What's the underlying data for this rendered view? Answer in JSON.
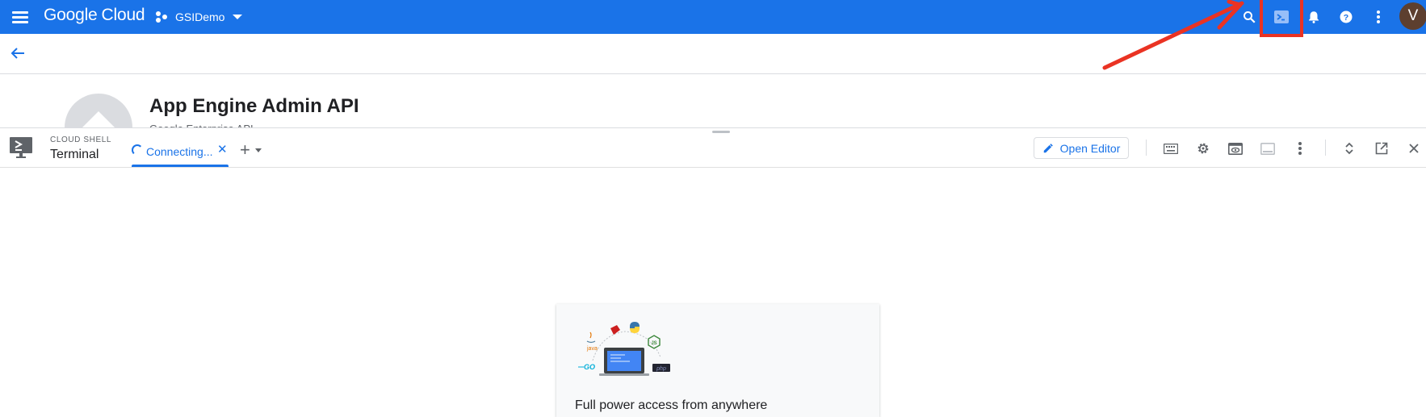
{
  "topbar": {
    "brand_google": "Google",
    "brand_cloud": "Cloud",
    "project_name": "GSIDemo",
    "avatar_initial": "V",
    "colors": {
      "bar": "#1a73e8",
      "highlight": "#ea3323",
      "avatar": "#5d3f2f"
    },
    "icons": [
      "menu-icon",
      "project-dots-icon",
      "search-icon",
      "cloud-shell-icon",
      "notifications-bell-icon",
      "help-icon",
      "more-vert-icon"
    ]
  },
  "page": {
    "title": "App Engine Admin API",
    "subtitle": "Google Enterprise API"
  },
  "cloud_shell": {
    "kicker": "CLOUD SHELL",
    "title": "Terminal",
    "tab_label": "Connecting...",
    "open_editor_label": "Open Editor",
    "icons": [
      "keyboard-icon",
      "settings-icon",
      "web-preview-icon",
      "minimize-panel-icon",
      "more-vert-icon",
      "expand-collapse-icon",
      "open-in-new-window-icon",
      "close-icon"
    ]
  },
  "welcome_card": {
    "text": "Full power access from anywhere",
    "badges": {
      "java": "java",
      "go": "GO",
      "js": "JS",
      "php": "php"
    }
  }
}
